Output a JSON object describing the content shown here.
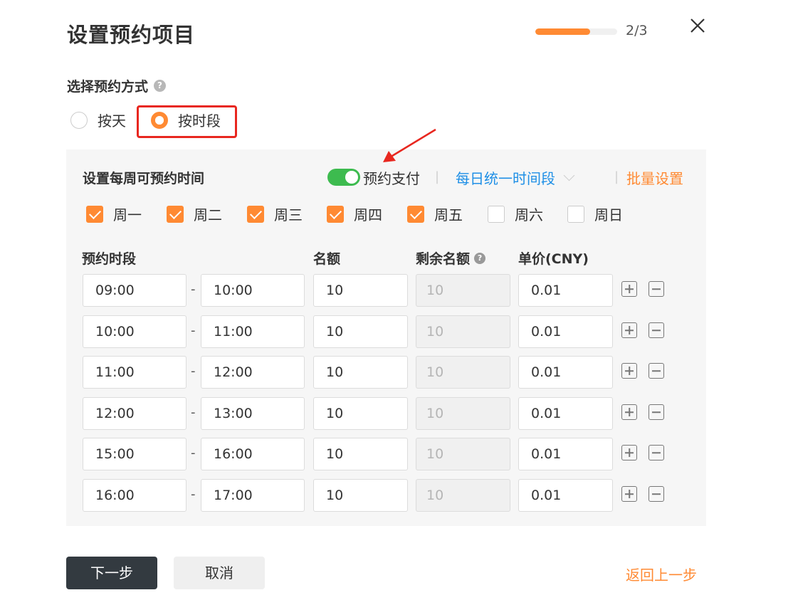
{
  "dialog": {
    "title": "设置预约项目",
    "progress_text": "2/3",
    "progress_fraction": 0.667
  },
  "method": {
    "label": "选择预约方式",
    "options": [
      {
        "label": "按天",
        "checked": false
      },
      {
        "label": "按时段",
        "checked": true
      }
    ]
  },
  "weekly": {
    "title": "设置每周可预约时间",
    "payment_toggle_label": "预约支付",
    "payment_toggle_on": true,
    "separator": "|",
    "daily_slot_label": "每日统一时间段",
    "batch_label": "批量设置",
    "days": [
      {
        "label": "周一",
        "checked": true
      },
      {
        "label": "周二",
        "checked": true
      },
      {
        "label": "周三",
        "checked": true
      },
      {
        "label": "周四",
        "checked": true
      },
      {
        "label": "周五",
        "checked": true
      },
      {
        "label": "周六",
        "checked": false
      },
      {
        "label": "周日",
        "checked": false
      }
    ]
  },
  "table": {
    "headers": {
      "slot": "预约时段",
      "quota": "名额",
      "remaining": "剩余名额",
      "price": "单价(CNY)"
    },
    "dash": "-",
    "rows": [
      {
        "start": "09:00",
        "end": "10:00",
        "quota": "10",
        "remaining": "10",
        "price": "0.01"
      },
      {
        "start": "10:00",
        "end": "11:00",
        "quota": "10",
        "remaining": "10",
        "price": "0.01"
      },
      {
        "start": "11:00",
        "end": "12:00",
        "quota": "10",
        "remaining": "10",
        "price": "0.01"
      },
      {
        "start": "12:00",
        "end": "13:00",
        "quota": "10",
        "remaining": "10",
        "price": "0.01"
      },
      {
        "start": "15:00",
        "end": "16:00",
        "quota": "10",
        "remaining": "10",
        "price": "0.01"
      },
      {
        "start": "16:00",
        "end": "17:00",
        "quota": "10",
        "remaining": "10",
        "price": "0.01"
      }
    ]
  },
  "footer": {
    "next_label": "下一步",
    "cancel_label": "取消",
    "back_label": "返回上一步"
  },
  "colors": {
    "accent": "#ff8a33",
    "link_blue": "#1e8fe6",
    "toggle_green": "#3dbb4f",
    "annotation_red": "#e8271f",
    "primary_button": "#333a40"
  },
  "icons": [
    "close-icon",
    "help-icon",
    "plus-icon",
    "minus-icon",
    "chevron-down-icon",
    "annotation-arrow"
  ]
}
